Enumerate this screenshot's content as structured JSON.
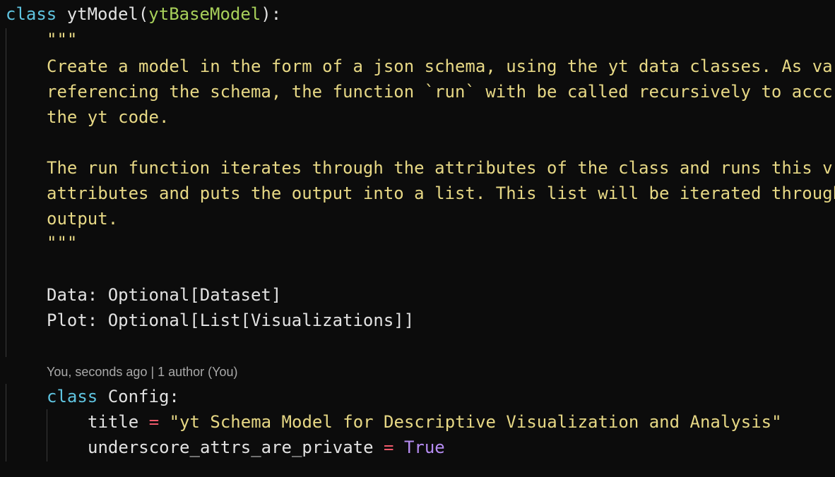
{
  "code": {
    "line1": {
      "keyword": "class",
      "name": " ytModel(",
      "base": "ytBaseModel",
      "end": "):"
    },
    "doc_open": "\"\"\"",
    "doc_lines": [
      "Create a model in the form of a json schema, using the yt data classes. As va",
      "referencing the schema, the function `run` with be called recursively to accc",
      "the yt code.",
      "",
      "The run function iterates through the attributes of the class and runs this v",
      "attributes and puts the output into a list. This list will be iterated through",
      "output."
    ],
    "doc_close": "\"\"\"",
    "fields": [
      "Data: Optional[Dataset]",
      "Plot: Optional[List[Visualizations]]"
    ],
    "codelens": "You, seconds ago | 1 author (You)",
    "config": {
      "keyword": "class",
      "name": " Config:"
    },
    "title_line": {
      "name": "title",
      "op": " = ",
      "value": "\"yt Schema Model for Descriptive Visualization and Analysis\""
    },
    "private_line": {
      "name": "underscore_attrs_are_private",
      "op": " = ",
      "value": "True"
    }
  }
}
